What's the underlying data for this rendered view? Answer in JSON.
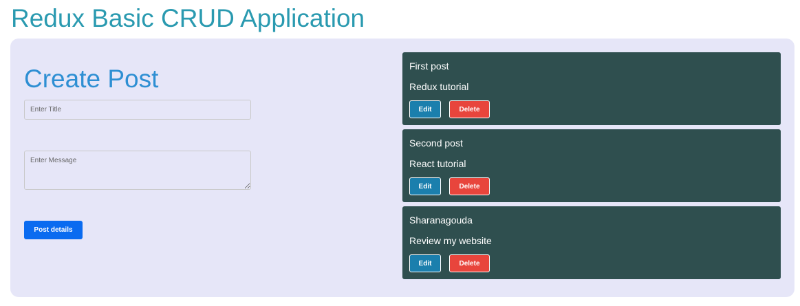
{
  "app": {
    "title": "Redux Basic CRUD Application"
  },
  "form": {
    "heading": "Create Post",
    "title_placeholder": "Enter Title",
    "message_placeholder": "Enter Message",
    "submit_label": "Post details"
  },
  "posts": [
    {
      "title": "First post",
      "message": "Redux tutorial",
      "edit_label": "Edit",
      "delete_label": "Delete"
    },
    {
      "title": "Second post",
      "message": "React tutorial",
      "edit_label": "Edit",
      "delete_label": "Delete"
    },
    {
      "title": "Sharanagouda",
      "message": "Review my website",
      "edit_label": "Edit",
      "delete_label": "Delete"
    }
  ],
  "colors": {
    "title": "#2a9ab0",
    "panel": "#e6e6f8",
    "card": "#2f4f4f",
    "edit": "#1b7fad",
    "delete": "#e8453c",
    "primary": "#0a6bf0"
  }
}
